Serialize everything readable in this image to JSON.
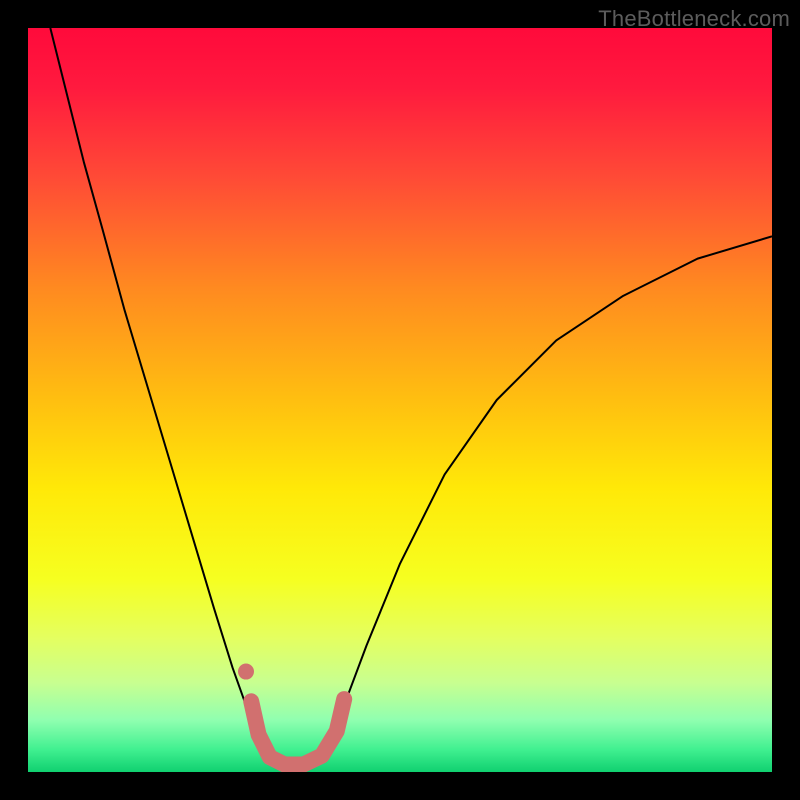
{
  "watermark": "TheBottleneck.com",
  "chart_data": {
    "type": "line",
    "title": "",
    "xlabel": "",
    "ylabel": "",
    "xlim": [
      0,
      1
    ],
    "ylim": [
      0,
      1
    ],
    "background_gradient": {
      "type": "vertical",
      "stops": [
        {
          "pos": 0.0,
          "color": "#ff0a3b"
        },
        {
          "pos": 0.08,
          "color": "#ff1a3e"
        },
        {
          "pos": 0.2,
          "color": "#ff4a36"
        },
        {
          "pos": 0.35,
          "color": "#ff8a20"
        },
        {
          "pos": 0.5,
          "color": "#ffbf10"
        },
        {
          "pos": 0.62,
          "color": "#ffe908"
        },
        {
          "pos": 0.74,
          "color": "#f6ff20"
        },
        {
          "pos": 0.82,
          "color": "#e4ff60"
        },
        {
          "pos": 0.88,
          "color": "#c8ff90"
        },
        {
          "pos": 0.93,
          "color": "#90ffb0"
        },
        {
          "pos": 0.97,
          "color": "#40f090"
        },
        {
          "pos": 1.0,
          "color": "#10d070"
        }
      ]
    },
    "series": [
      {
        "name": "curve-left",
        "color": "#000000",
        "stroke_width": 2,
        "x": [
          0.03,
          0.05,
          0.075,
          0.1,
          0.13,
          0.16,
          0.19,
          0.22,
          0.25,
          0.275,
          0.3,
          0.32
        ],
        "y": [
          1.0,
          0.92,
          0.82,
          0.73,
          0.62,
          0.52,
          0.42,
          0.32,
          0.22,
          0.14,
          0.07,
          0.035
        ]
      },
      {
        "name": "curve-right",
        "color": "#000000",
        "stroke_width": 2,
        "x": [
          0.4,
          0.425,
          0.455,
          0.5,
          0.56,
          0.63,
          0.71,
          0.8,
          0.9,
          1.0
        ],
        "y": [
          0.035,
          0.09,
          0.17,
          0.28,
          0.4,
          0.5,
          0.58,
          0.64,
          0.69,
          0.72
        ]
      },
      {
        "name": "highlight-bottom",
        "color": "#d1706f",
        "stroke_width": 16,
        "linecap": "round",
        "x": [
          0.3,
          0.31,
          0.325,
          0.345,
          0.37,
          0.395,
          0.415,
          0.425
        ],
        "y": [
          0.095,
          0.05,
          0.02,
          0.01,
          0.01,
          0.022,
          0.055,
          0.098
        ]
      },
      {
        "name": "highlight-dot",
        "type": "scatter",
        "color": "#d1706f",
        "radius": 8,
        "x": [
          0.293
        ],
        "y": [
          0.135
        ]
      }
    ]
  }
}
